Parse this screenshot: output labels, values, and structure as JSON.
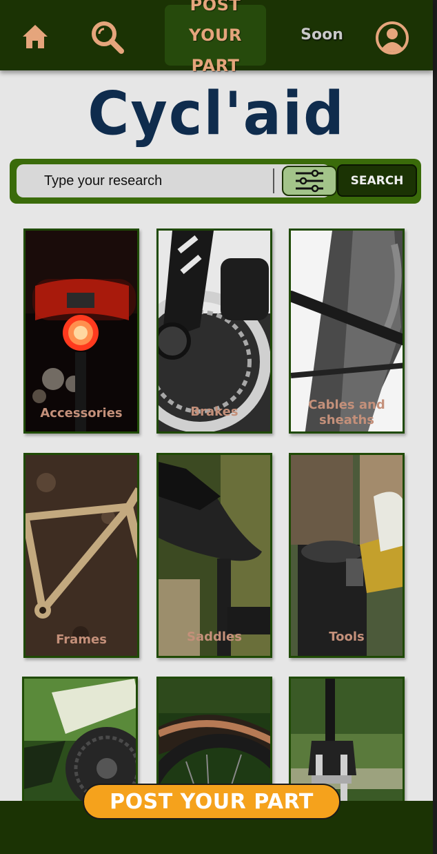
{
  "nav": {
    "post_label_line1": "POST YOUR",
    "post_label_line2": "PART",
    "soon_label": "Soon",
    "accent_color": "#e5a57c",
    "bg_color": "#1b3304"
  },
  "logo": {
    "text": "Cycl'aid",
    "color": "#0f2c4d"
  },
  "search": {
    "placeholder": "Type your research",
    "button_label": "SEARCH"
  },
  "categories": [
    {
      "label": "Accessories"
    },
    {
      "label": "Brakes"
    },
    {
      "label": "Cables and sheaths"
    },
    {
      "label": "Frames"
    },
    {
      "label": "Saddles"
    },
    {
      "label": "Tools"
    },
    {
      "label": ""
    },
    {
      "label": ""
    },
    {
      "label": ""
    }
  ],
  "bottom": {
    "post_label": "POST YOUR PART",
    "button_color": "#f5a21c"
  }
}
